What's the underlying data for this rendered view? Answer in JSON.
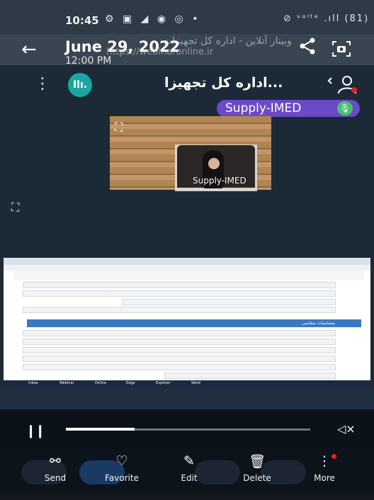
{
  "status_bar": {
    "time": "10:45",
    "icons": "⚙ ▣ ◢ ◉ ◎ •",
    "right_icons": "⊘ ᵛᵒˡᵗᵉ .ıll (81)"
  },
  "header": {
    "date": "June 29, 2022",
    "time": "12:00 PM",
    "background_title": "وبینار آنلاین - اداره کل تجهیزات",
    "background_url": "https://webinaronline.ir"
  },
  "meeting": {
    "title": "اداره کل تجهیزا...",
    "stats_label": "Ilı.",
    "presenter_name": "Supply-IMED",
    "tile_label": "Supply-IMED"
  },
  "shared_screen": {
    "section_title": "مشخصات متقاضی",
    "taskbar_items": [
      "Inbox",
      "Webinar",
      "Online",
      "Edge",
      "Explorer",
      "Word"
    ]
  },
  "player": {
    "progress": 0.28
  },
  "actions": [
    {
      "label": "Send",
      "icon": "share-icon"
    },
    {
      "label": "Favorite",
      "icon": "heart-icon"
    },
    {
      "label": "Edit",
      "icon": "pencil-icon"
    },
    {
      "label": "Delete",
      "icon": "trash-icon"
    },
    {
      "label": "More",
      "icon": "more-icon"
    }
  ],
  "colors": {
    "presenter_badge": "#6b49c7",
    "stats_button": "#1aa7a1",
    "mic": "#4bbf73",
    "notification_dot": "#e02020"
  }
}
